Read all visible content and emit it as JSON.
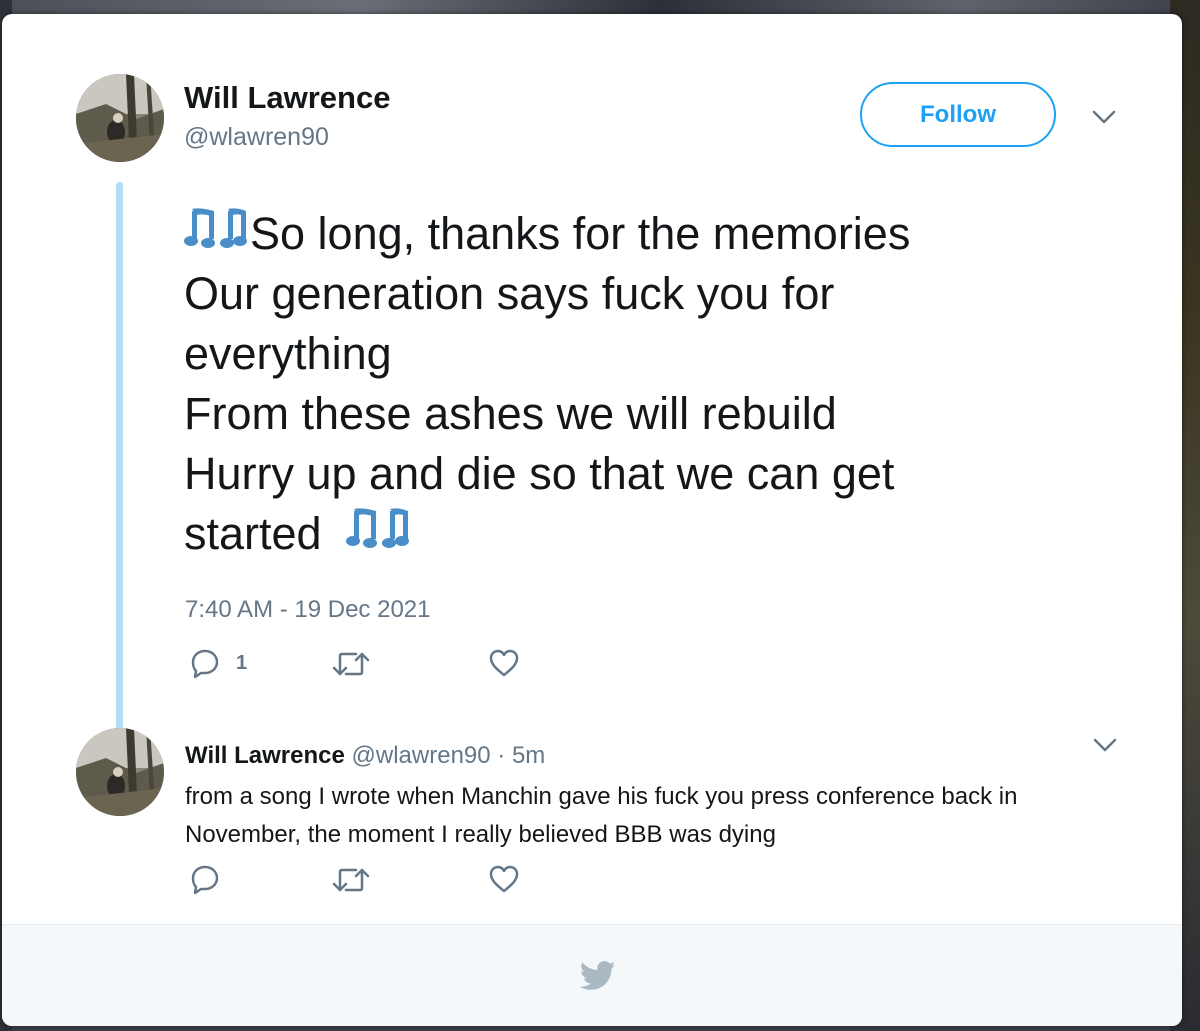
{
  "tweet": {
    "author_name": "Will Lawrence",
    "author_handle": "@wlawren90",
    "follow_label": "Follow",
    "text_lines": [
      "So long, thanks for the memories",
      "Our generation says fuck you for",
      "everything",
      "From these ashes we will rebuild",
      "Hurry up and die so that we can get",
      "started"
    ],
    "timestamp": "7:40 AM - 19 Dec 2021",
    "reply_count": "1"
  },
  "reply": {
    "author_name": "Will Lawrence",
    "author_handle": "@wlawren90",
    "separator": "·",
    "time": "5m",
    "text": "from a song I wrote when Manchin gave his fuck you press conference back in November, the moment I really believed BBB was dying"
  },
  "icons": {
    "music_notes": "music-notes-icon",
    "reply": "reply-icon",
    "retweet": "retweet-icon",
    "like": "heart-icon",
    "chevron": "chevron-down-icon",
    "footer": "twitter-bird-icon"
  },
  "colors": {
    "accent": "#1da1f2",
    "thread_line": "#b3dcf7",
    "text": "#14171a",
    "secondary_text": "#657786",
    "icon": "#4a8ec9",
    "footer_bg": "#f5f8fa"
  }
}
